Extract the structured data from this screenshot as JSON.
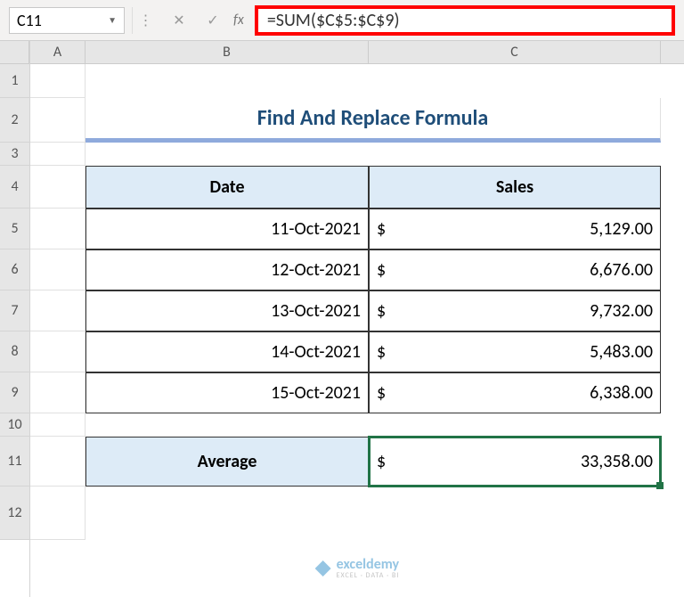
{
  "name_box": "C11",
  "formula": "=SUM($C$5:$C$9)",
  "title": "Find And Replace Formula",
  "headers": {
    "date": "Date",
    "sales": "Sales"
  },
  "rows": [
    {
      "date": "11-Oct-2021",
      "currency": "$",
      "sales": "5,129.00"
    },
    {
      "date": "12-Oct-2021",
      "currency": "$",
      "sales": "6,676.00"
    },
    {
      "date": "13-Oct-2021",
      "currency": "$",
      "sales": "9,732.00"
    },
    {
      "date": "14-Oct-2021",
      "currency": "$",
      "sales": "5,483.00"
    },
    {
      "date": "15-Oct-2021",
      "currency": "$",
      "sales": "6,338.00"
    }
  ],
  "summary": {
    "label": "Average",
    "currency": "$",
    "value": "33,358.00"
  },
  "columns": [
    "A",
    "B",
    "C"
  ],
  "row_nums": [
    "1",
    "2",
    "3",
    "4",
    "5",
    "6",
    "7",
    "8",
    "9",
    "10",
    "11",
    "12"
  ],
  "watermark": {
    "brand": "exceldemy",
    "tag": "EXCEL · DATA · BI"
  },
  "chart_data": {
    "type": "table",
    "title": "Find And Replace Formula",
    "columns": [
      "Date",
      "Sales"
    ],
    "rows": [
      [
        "11-Oct-2021",
        5129.0
      ],
      [
        "12-Oct-2021",
        6676.0
      ],
      [
        "13-Oct-2021",
        9732.0
      ],
      [
        "14-Oct-2021",
        5483.0
      ],
      [
        "15-Oct-2021",
        6338.0
      ]
    ],
    "summary": {
      "label": "Average",
      "value": 33358.0,
      "formula": "=SUM($C$5:$C$9)"
    }
  }
}
